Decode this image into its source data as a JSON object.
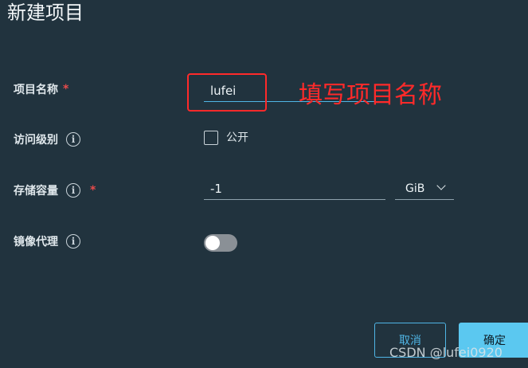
{
  "dialog": {
    "title": "新建项目"
  },
  "form": {
    "project_name": {
      "label": "项目名称",
      "required_mark": "*",
      "value": "lufei"
    },
    "access_level": {
      "label": "访问级别",
      "info": "i",
      "checkbox_label": "公开",
      "checked": false
    },
    "storage_quota": {
      "label": "存储容量",
      "info": "i",
      "required_mark": "*",
      "value": "-1",
      "unit": "GiB"
    },
    "proxy_cache": {
      "label": "镜像代理",
      "info": "i",
      "enabled": false
    }
  },
  "annotation": {
    "text": "填写项目名称",
    "color": "#ff2a2a"
  },
  "buttons": {
    "cancel": "取消",
    "ok": "确定"
  },
  "watermark": "CSDN @lufei0920",
  "colors": {
    "background": "#21333e",
    "accent": "#4fb5e5",
    "primary_button": "#5bc8f0",
    "required": "#e84b4b"
  }
}
